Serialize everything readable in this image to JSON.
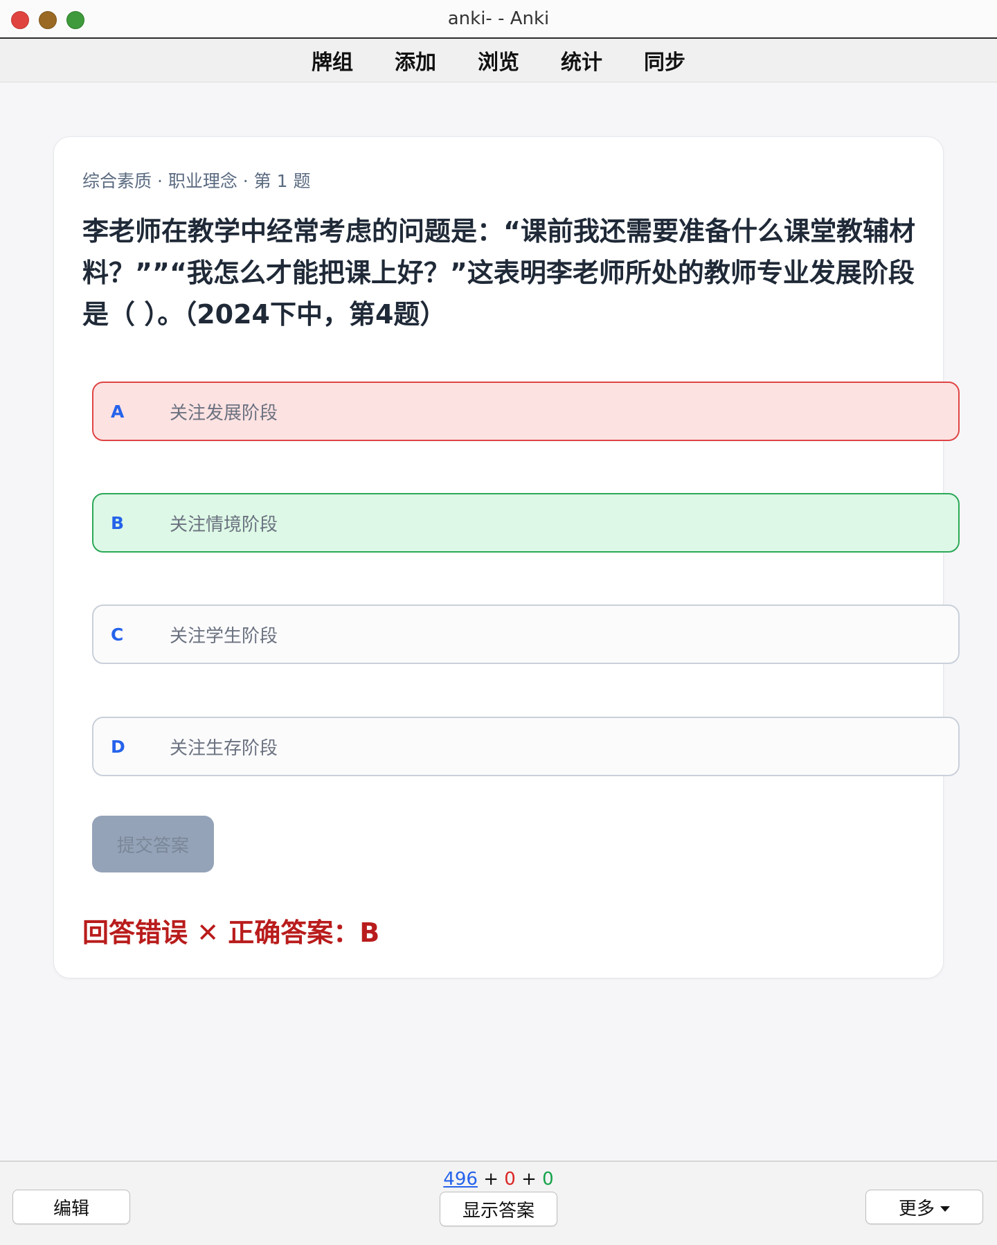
{
  "window": {
    "title": "anki- - Anki"
  },
  "nav": {
    "items": [
      "牌组",
      "添加",
      "浏览",
      "统计",
      "同步"
    ]
  },
  "card": {
    "meta": "综合素质 · 职业理念 · 第 1 题",
    "question": "李老师在教学中经常考虑的问题是：“课前我还需要准备什么课堂教辅材料？””“我怎么才能把课上好？”这表明李老师所处的教师专业发展阶段是（ ）。（2024下中，第4题）",
    "options": [
      {
        "letter": "A",
        "text": "关注发展阶段",
        "state": "wrong"
      },
      {
        "letter": "B",
        "text": "关注情境阶段",
        "state": "correct"
      },
      {
        "letter": "C",
        "text": "关注学生阶段",
        "state": "neutral"
      },
      {
        "letter": "D",
        "text": "关注生存阶段",
        "state": "neutral"
      }
    ],
    "submit_label": "提交答案",
    "result": "回答错误 ✕ 正确答案：B"
  },
  "bottom": {
    "edit_label": "编辑",
    "show_answer_label": "显示答案",
    "more_label": "更多",
    "counts": {
      "new": "496",
      "learn": "0",
      "review": "0",
      "plus": "+"
    }
  },
  "colors": {
    "wrong_border": "#e04444",
    "correct_border": "#2aa857",
    "letter": "#2563eb",
    "result": "#b91c1c"
  }
}
